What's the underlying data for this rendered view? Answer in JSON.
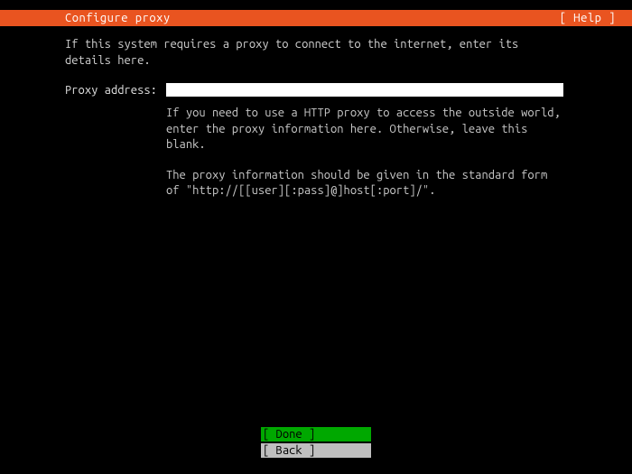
{
  "header": {
    "title": "Configure proxy",
    "help": "[ Help ]"
  },
  "intro": "If this system requires a proxy to connect to the internet, enter its details here.",
  "form": {
    "proxy_label": "Proxy address:",
    "proxy_value": "",
    "hint1": "If you need to use a HTTP proxy to access the outside world, enter the proxy information here. Otherwise, leave this blank.",
    "hint2": "The proxy information should be given in the standard form of \"http://[[user][:pass]@]host[:port]/\"."
  },
  "footer": {
    "done": "[ Done       ]",
    "back": "[ Back       ]"
  }
}
